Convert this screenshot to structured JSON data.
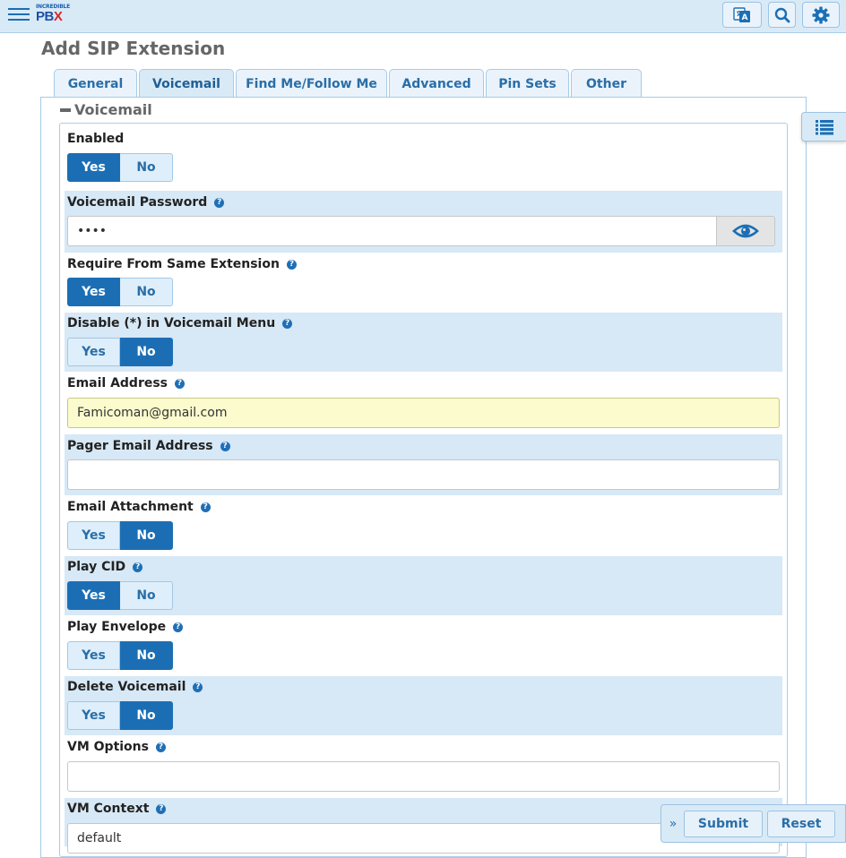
{
  "app": {
    "logo_small": "INCREDIBLE",
    "logo_big_1": "PB",
    "logo_big_2": "X",
    "page_title": "Add SIP Extension"
  },
  "toolbar": {
    "icons": [
      "menu-icon",
      "translate-icon",
      "search-icon",
      "gear-icon"
    ]
  },
  "tabs": [
    {
      "label": "General",
      "active": false
    },
    {
      "label": "Voicemail",
      "active": true
    },
    {
      "label": "Find Me/Follow Me",
      "active": false
    },
    {
      "label": "Advanced",
      "active": false
    },
    {
      "label": "Pin Sets",
      "active": false
    },
    {
      "label": "Other",
      "active": false
    }
  ],
  "section": {
    "title": "Voicemail"
  },
  "fields": {
    "enabled": {
      "label": "Enabled",
      "yes": "Yes",
      "no": "No",
      "selected": "Yes"
    },
    "vm_password": {
      "label": "Voicemail Password",
      "value": "••••"
    },
    "require_same_ext": {
      "label": "Require From Same Extension",
      "yes": "Yes",
      "no": "No",
      "selected": "Yes"
    },
    "disable_star": {
      "label": "Disable (*) in Voicemail Menu",
      "yes": "Yes",
      "no": "No",
      "selected": "No"
    },
    "email": {
      "label": "Email Address",
      "value": "Famicoman@gmail.com"
    },
    "pager_email": {
      "label": "Pager Email Address",
      "value": ""
    },
    "email_attachment": {
      "label": "Email Attachment",
      "yes": "Yes",
      "no": "No",
      "selected": "No"
    },
    "play_cid": {
      "label": "Play CID",
      "yes": "Yes",
      "no": "No",
      "selected": "Yes"
    },
    "play_envelope": {
      "label": "Play Envelope",
      "yes": "Yes",
      "no": "No",
      "selected": "No"
    },
    "delete_vm": {
      "label": "Delete Voicemail",
      "yes": "Yes",
      "no": "No",
      "selected": "No"
    },
    "vm_options": {
      "label": "VM Options",
      "value": ""
    },
    "vm_context": {
      "label": "VM Context",
      "value": "default"
    }
  },
  "actions": {
    "submit": "Submit",
    "reset": "Reset"
  },
  "colors": {
    "accent": "#1c6eb4",
    "header_bg": "#d9eaf7",
    "row_shade": "#d7e8f6",
    "autofill_bg": "#fbfbcd"
  }
}
